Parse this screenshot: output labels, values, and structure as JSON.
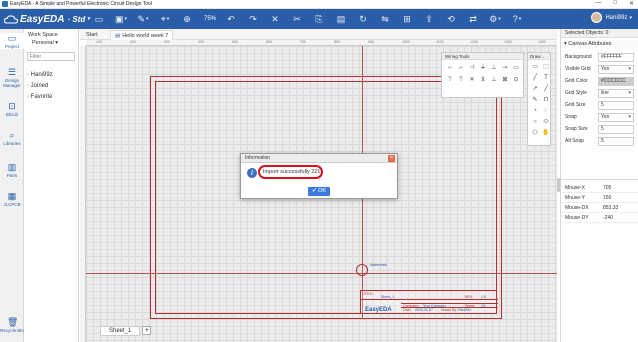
{
  "window": {
    "title": "EasyEDA - A Simple and Powerful Electronic Circuit Design Tool",
    "minimize": "—",
    "maximize": "□",
    "close": "✕"
  },
  "toolbar": {
    "brand": "EasyEDA",
    "edition": "· Std",
    "zoom": "75%",
    "user": "Hani99z",
    "colors": {
      "bar": "#2a5ea8"
    }
  },
  "rail": {
    "items": [
      {
        "label": "Project"
      },
      {
        "label": "Design Manager"
      },
      {
        "label": "EELib"
      },
      {
        "label": "Libraries"
      },
      {
        "label": "Parts"
      },
      {
        "label": "JLCPCB"
      },
      {
        "label": "Recycle Bin"
      }
    ]
  },
  "left_panel": {
    "title": "Work Space",
    "workspace": "Personal ▾",
    "filter_placeholder": "Filter",
    "items": [
      "Hani99z",
      "Joined",
      "Favorite"
    ]
  },
  "tabs": {
    "start": "Start",
    "doc": "Hello world week 7"
  },
  "wiring_tools": {
    "title": "Wiring Tools",
    "icons": [
      "⌐",
      "⌐",
      "⊣",
      "⏚",
      "⊥",
      "⊸",
      "▭",
      "⊤",
      "⊤",
      "✕",
      "⊻",
      "⊥",
      "⊠",
      "⊙"
    ]
  },
  "drawing_tools": {
    "title": "Draw...",
    "icons": [
      "▭",
      "⬚",
      "╱",
      "T",
      "↗",
      "╱",
      "✎",
      "⊓",
      "◔",
      "◌",
      "○",
      "⬭",
      "⬡",
      "✋"
    ]
  },
  "right_panel": {
    "header": "Selected Objects",
    "count": "0",
    "section": "Canvas Attributes",
    "rows": [
      {
        "k": "Background",
        "v": "#FFFFFF",
        "sel": false
      },
      {
        "k": "Visible Grid",
        "v": "Yes",
        "sel": true
      },
      {
        "k": "Grid Color",
        "v": "#CCCCCC",
        "sel": false
      },
      {
        "k": "Grid Style",
        "v": "line",
        "sel": true
      },
      {
        "k": "Grid Size",
        "v": "5",
        "sel": false
      },
      {
        "k": "Snap",
        "v": "Yes",
        "sel": true
      },
      {
        "k": "Snap Size",
        "v": "5",
        "sel": false
      },
      {
        "k": "Alt Snap",
        "v": "5",
        "sel": false
      }
    ],
    "mouse": [
      {
        "k": "Mouse-X",
        "v": "705"
      },
      {
        "k": "Mouse-Y",
        "v": "150"
      },
      {
        "k": "Mouse-DX",
        "v": "853.33"
      },
      {
        "k": "Mouse-DY",
        "v": "-240"
      }
    ]
  },
  "ruler": {
    "ticks": [
      "100",
      "200",
      "300",
      "400",
      "500",
      "600",
      "700",
      "800",
      "900",
      "1000",
      "1100",
      "1200",
      "1300",
      "1400"
    ]
  },
  "titleblock": {
    "title_lbl": "TITLE:",
    "title": "Sheet_1",
    "rev_lbl": "REV:",
    "rev": "1.0",
    "company_lbl": "Company:",
    "company": "Your Company",
    "date_lbl": "Date:",
    "date": "2020-02-07",
    "drawn_lbl": "Drawn By:",
    "drawn": "Hani99z",
    "sheet_lbl": "Sheet:",
    "sheet": "1/1",
    "brand": "EasyEDA",
    "watermark": "Watermark"
  },
  "sheets": {
    "tab": "Sheet_1",
    "add": "+"
  },
  "dialog": {
    "title": "Information",
    "message": "Import successfully 221",
    "ok": "✔ OK",
    "close": "✕",
    "icon": "i",
    "highlight_color": "#d80f1c"
  }
}
